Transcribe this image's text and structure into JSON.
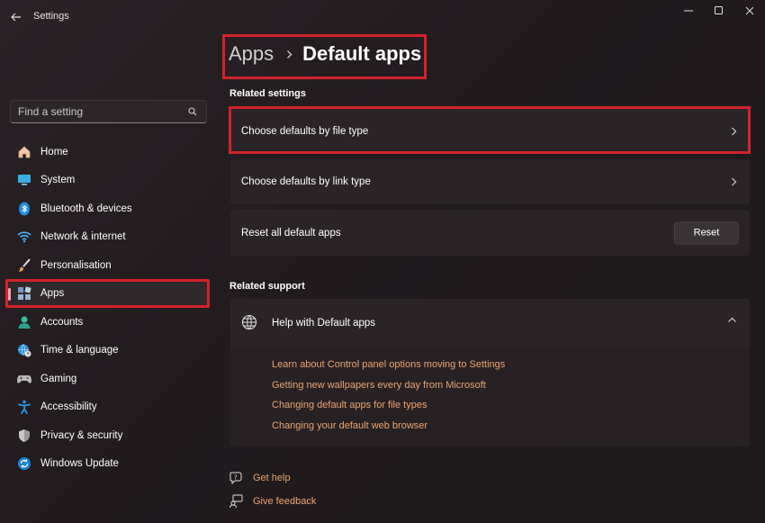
{
  "window": {
    "title": "Settings",
    "controls": [
      "minimize-icon",
      "maximize-icon",
      "close-icon"
    ]
  },
  "search": {
    "placeholder": "Find a setting"
  },
  "sidebar": {
    "items": [
      {
        "label": "Home",
        "icon": "home-icon"
      },
      {
        "label": "System",
        "icon": "monitor-icon"
      },
      {
        "label": "Bluetooth & devices",
        "icon": "bluetooth-icon"
      },
      {
        "label": "Network & internet",
        "icon": "wifi-icon"
      },
      {
        "label": "Personalisation",
        "icon": "brush-icon"
      },
      {
        "label": "Apps",
        "icon": "apps-icon",
        "active": true
      },
      {
        "label": "Accounts",
        "icon": "account-icon"
      },
      {
        "label": "Time & language",
        "icon": "globe-clock-icon"
      },
      {
        "label": "Gaming",
        "icon": "gamepad-icon"
      },
      {
        "label": "Accessibility",
        "icon": "accessibility-icon"
      },
      {
        "label": "Privacy & security",
        "icon": "shield-icon"
      },
      {
        "label": "Windows Update",
        "icon": "update-icon"
      }
    ]
  },
  "breadcrumb": {
    "parent": "Apps",
    "current": "Default apps"
  },
  "related_settings": {
    "heading": "Related settings",
    "file_type": "Choose defaults by file type",
    "link_type": "Choose defaults by link type",
    "reset_label": "Reset all default apps",
    "reset_button": "Reset"
  },
  "related_support": {
    "heading": "Related support",
    "help_title": "Help with Default apps",
    "links": [
      "Learn about Control panel options moving to Settings",
      "Getting new wallpapers every day from Microsoft",
      "Changing default apps for file types",
      "Changing your default web browser"
    ]
  },
  "footer": {
    "get_help": "Get help",
    "give_feedback": "Give feedback"
  },
  "colors": {
    "accent_link": "#eaa46f",
    "highlight_border": "#d1232a",
    "active_indicator": "#e7a7b0"
  }
}
